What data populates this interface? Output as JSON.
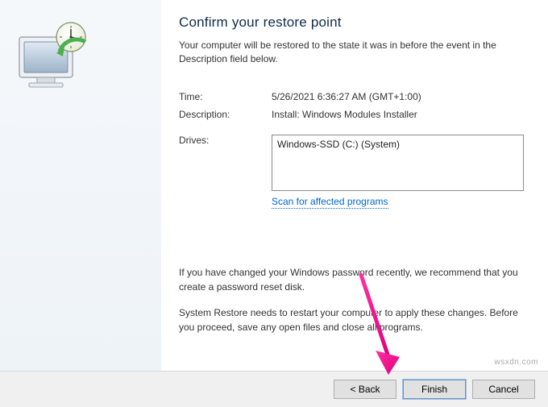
{
  "header": {
    "title": "Confirm your restore point",
    "subtitle": "Your computer will be restored to the state it was in before the event in the Description field below."
  },
  "info": {
    "time_label": "Time:",
    "time_value": "5/26/2021 6:36:27 AM (GMT+1:00)",
    "desc_label": "Description:",
    "desc_value": "Install: Windows Modules Installer",
    "drives_label": "Drives:",
    "drives_value": "Windows-SSD (C:) (System)"
  },
  "scan_link": "Scan for affected programs",
  "notes": {
    "p1": "If you have changed your Windows password recently, we recommend that you create a password reset disk.",
    "p2": "System Restore needs to restart your computer to apply these changes. Before you proceed, save any open files and close all programs."
  },
  "buttons": {
    "back": "< Back",
    "finish": "Finish",
    "cancel": "Cancel"
  },
  "watermark": "wsxdn.com"
}
